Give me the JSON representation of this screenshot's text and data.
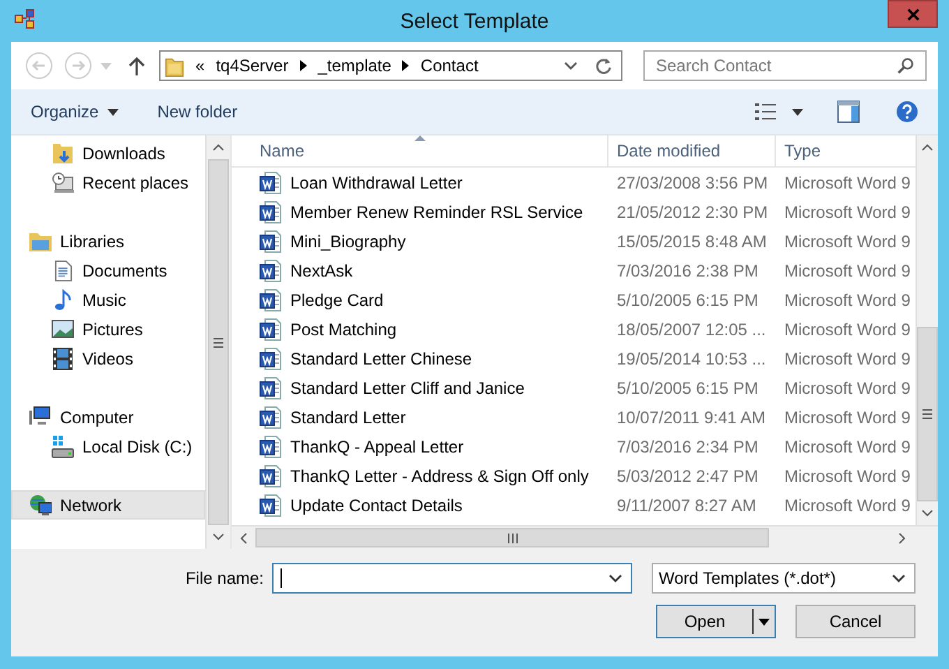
{
  "window": {
    "title": "Select Template"
  },
  "address_bar": {
    "overflow": "«",
    "crumbs": [
      "tq4Server",
      "_template",
      "Contact"
    ]
  },
  "search": {
    "placeholder": "Search Contact"
  },
  "toolbar": {
    "organize": "Organize",
    "new_folder": "New folder"
  },
  "sidebar": {
    "groups": [
      {
        "children": [
          {
            "label": "Downloads",
            "kind": "downloads",
            "selected": false
          },
          {
            "label": "Recent places",
            "kind": "recent",
            "selected": false
          }
        ]
      },
      {
        "label": "Libraries",
        "kind": "library",
        "selected": false,
        "children": [
          {
            "label": "Documents",
            "kind": "documents",
            "selected": false
          },
          {
            "label": "Music",
            "kind": "music",
            "selected": false
          },
          {
            "label": "Pictures",
            "kind": "pictures",
            "selected": false
          },
          {
            "label": "Videos",
            "kind": "videos",
            "selected": false
          }
        ]
      },
      {
        "label": "Computer",
        "kind": "computer",
        "selected": false,
        "children": [
          {
            "label": "Local Disk (C:)",
            "kind": "disk",
            "selected": false
          }
        ]
      },
      {
        "label": "Network",
        "kind": "network",
        "selected": true
      }
    ]
  },
  "table": {
    "columns": [
      {
        "label": "Name",
        "sorted": true
      },
      {
        "label": "Date modified",
        "sorted": false
      },
      {
        "label": "Type",
        "sorted": false
      }
    ],
    "rows": [
      {
        "name": "Loan Withdrawal Letter",
        "date": "27/03/2008 3:56 PM",
        "type": "Microsoft Word 9",
        "selected": false
      },
      {
        "name": "Member Renew Reminder RSL Service",
        "date": "21/05/2012 2:30 PM",
        "type": "Microsoft Word 9",
        "selected": false
      },
      {
        "name": "Mini_Biography",
        "date": "15/05/2015 8:48 AM",
        "type": "Microsoft Word 9",
        "selected": false
      },
      {
        "name": "NextAsk",
        "date": "7/03/2016 2:38 PM",
        "type": "Microsoft Word 9",
        "selected": false
      },
      {
        "name": "Pledge Card",
        "date": "5/10/2005 6:15 PM",
        "type": "Microsoft Word 9",
        "selected": false
      },
      {
        "name": "Post Matching",
        "date": "18/05/2007 12:05 ...",
        "type": "Microsoft Word 9",
        "selected": false
      },
      {
        "name": "Standard Letter Chinese",
        "date": "19/05/2014 10:53 ...",
        "type": "Microsoft Word 9",
        "selected": false
      },
      {
        "name": "Standard Letter Cliff and Janice",
        "date": "5/10/2005 6:15 PM",
        "type": "Microsoft Word 9",
        "selected": false
      },
      {
        "name": "Standard Letter",
        "date": "10/07/2011 9:41 AM",
        "type": "Microsoft Word 9",
        "selected": false
      },
      {
        "name": "ThankQ - Appeal Letter",
        "date": "7/03/2016 2:34 PM",
        "type": "Microsoft Word 9",
        "selected": false
      },
      {
        "name": "ThankQ Letter - Address & Sign Off only",
        "date": "5/03/2012 2:47 PM",
        "type": "Microsoft Word 9",
        "selected": false
      },
      {
        "name": "Update Contact Details",
        "date": "9/11/2007 8:27 AM",
        "type": "Microsoft Word 9",
        "selected": false
      }
    ]
  },
  "footer": {
    "file_name_label": "File name:",
    "file_type": "Word Templates (*.dot*)",
    "buttons": [
      {
        "label": "Open",
        "kind": "split"
      },
      {
        "label": "Cancel",
        "kind": "plain"
      }
    ]
  }
}
